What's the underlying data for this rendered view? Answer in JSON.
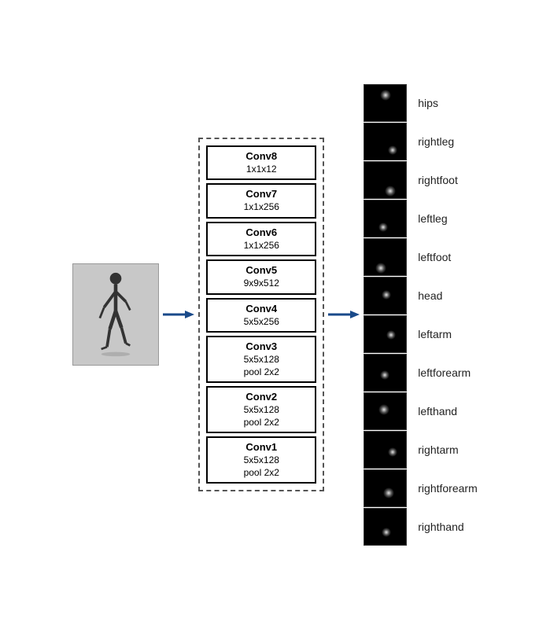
{
  "diagram": {
    "arrow_label": "→",
    "input": {
      "alt": "Person walking input image"
    },
    "network": {
      "layers": [
        {
          "id": "conv8",
          "name": "Conv8",
          "params": "1x1x12"
        },
        {
          "id": "conv7",
          "name": "Conv7",
          "params": "1x1x256"
        },
        {
          "id": "conv6",
          "name": "Conv6",
          "params": "1x1x256"
        },
        {
          "id": "conv5",
          "name": "Conv5",
          "params": "9x9x512"
        },
        {
          "id": "conv4",
          "name": "Conv4",
          "params": "5x5x256"
        },
        {
          "id": "conv3",
          "name": "Conv3",
          "params": "5x5x128",
          "extra": "pool 2x2"
        },
        {
          "id": "conv2",
          "name": "Conv2",
          "params": "5x5x128",
          "extra": "pool 2x2"
        },
        {
          "id": "conv1",
          "name": "Conv1",
          "params": "5x5x128",
          "extra": "pool 2x2"
        }
      ]
    },
    "outputs": [
      {
        "id": 1,
        "label": "hips"
      },
      {
        "id": 2,
        "label": "rightleg"
      },
      {
        "id": 3,
        "label": "rightfoot"
      },
      {
        "id": 4,
        "label": "leftleg"
      },
      {
        "id": 5,
        "label": "leftfoot"
      },
      {
        "id": 6,
        "label": "head"
      },
      {
        "id": 7,
        "label": "leftarm"
      },
      {
        "id": 8,
        "label": "leftforearm"
      },
      {
        "id": 9,
        "label": "lefthand"
      },
      {
        "id": 10,
        "label": "rightarm"
      },
      {
        "id": 11,
        "label": "rightforearm"
      },
      {
        "id": 12,
        "label": "righthand"
      }
    ]
  }
}
